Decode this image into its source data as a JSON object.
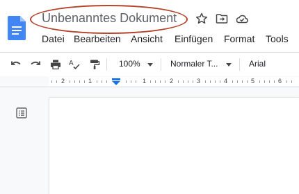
{
  "header": {
    "title": "Unbenanntes Dokument",
    "icons": [
      "docs-logo-icon",
      "star-icon",
      "move-folder-icon",
      "cloud-status-icon"
    ]
  },
  "menu": [
    {
      "label": "Datei"
    },
    {
      "label": "Bearbeiten"
    },
    {
      "label": "Ansicht"
    },
    {
      "label": "Einfügen"
    },
    {
      "label": "Format"
    },
    {
      "label": "Tools"
    }
  ],
  "toolbar": {
    "zoom": "100%",
    "style": "Normaler T...",
    "font": "Arial",
    "icons": [
      "undo-icon",
      "redo-icon",
      "print-icon",
      "spellcheck-icon",
      "paint-format-icon"
    ]
  },
  "ruler": {
    "labels": [
      "2",
      "1",
      "1",
      "2",
      "3",
      "4",
      "5",
      "6"
    ]
  },
  "colors": {
    "annotation_oval": "#b3432b",
    "docs_blue": "#4285f4",
    "ruler_marker": "#1a73e8"
  }
}
